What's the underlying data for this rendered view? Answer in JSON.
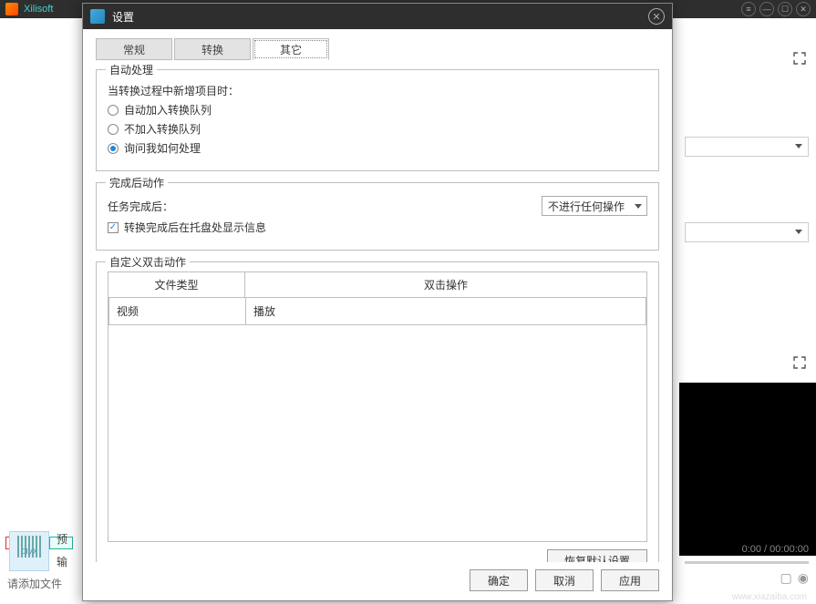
{
  "app": {
    "name": "Xilisoft"
  },
  "window_buttons": {
    "menu": "≡",
    "min": "—",
    "max": "☐",
    "close": "✕"
  },
  "dialog": {
    "title": "设置",
    "close": "✕",
    "tabs": {
      "general": "常规",
      "convert": "转换",
      "other": "其它"
    },
    "auto": {
      "legend": "自动处理",
      "prompt": "当转换过程中新增项目时：",
      "opt1": "自动加入转换队列",
      "opt2": "不加入转换队列",
      "opt3": "询问我如何处理",
      "selected": 3
    },
    "post": {
      "legend": "完成后动作",
      "label": "任务完成后：",
      "select_value": "不进行任何操作",
      "tray_checkbox": "转换完成后在托盘处显示信息",
      "tray_checked": true
    },
    "dblclick": {
      "legend": "自定义双击动作",
      "col_type": "文件类型",
      "col_action": "双击操作",
      "rows": [
        {
          "type": "视频",
          "action": "播放"
        }
      ]
    },
    "buttons": {
      "restore": "恢复默认设置",
      "ok": "确定",
      "cancel": "取消",
      "apply": "应用"
    }
  },
  "main": {
    "time": "0:00 / 00:00:00",
    "labels": {
      "preset": "预",
      "output": "输"
    },
    "add_file": "请添加文件",
    "watermark": "www.xiazaiba.com"
  }
}
